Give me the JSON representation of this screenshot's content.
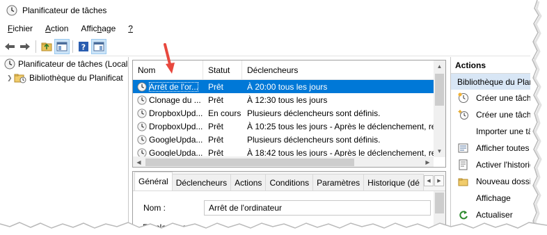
{
  "window": {
    "title": "Planificateur de tâches",
    "icon": "clock-icon"
  },
  "menu": [
    {
      "label": "Fichier",
      "underline": "F"
    },
    {
      "label": "Action",
      "underline": "A"
    },
    {
      "label": "Affichage",
      "underline": "h"
    },
    {
      "label": "?",
      "underline": "?"
    }
  ],
  "toolbar": {
    "buttons": [
      "back-arrow-icon",
      "forward-arrow-icon",
      "folder-up-icon",
      "show-hide-tree-icon",
      "help-icon",
      "show-hide-actions-icon"
    ]
  },
  "tree": {
    "root_label": "Planificateur de tâches (Local",
    "child_label": "Bibliothèque du Planificat"
  },
  "grid": {
    "headers": {
      "name": "Nom",
      "status": "Statut",
      "triggers": "Déclencheurs"
    },
    "rows": [
      {
        "name": "Arrêt de l'or...",
        "status": "Prêt",
        "triggers": "À 20:00 tous les jours",
        "selected": true
      },
      {
        "name": "Clonage du ...",
        "status": "Prêt",
        "triggers": "À 12:30 tous les jours",
        "selected": false
      },
      {
        "name": "DropboxUpd...",
        "status": "En cours",
        "triggers": "Plusieurs déclencheurs sont définis.",
        "selected": false
      },
      {
        "name": "DropboxUpd...",
        "status": "Prêt",
        "triggers": "À 10:25 tous les jours - Après le déclenchement, red",
        "selected": false
      },
      {
        "name": "GoogleUpda...",
        "status": "Prêt",
        "triggers": "Plusieurs déclencheurs sont définis.",
        "selected": false
      },
      {
        "name": "GoogleUpda...",
        "status": "Prêt",
        "triggers": "À 18:42 tous les jours - Après le déclenchement, rec",
        "selected": false
      }
    ]
  },
  "detail": {
    "tabs": [
      "Général",
      "Déclencheurs",
      "Actions",
      "Conditions",
      "Paramètres",
      "Historique (dé"
    ],
    "active_tab": 0,
    "name_label": "Nom :",
    "name_value": "Arrêt de l'ordinateur",
    "partial_label": "Emplacement :"
  },
  "actions": {
    "header": "Actions",
    "section": "Bibliothèque du Planificateur",
    "items": [
      {
        "label": "Créer une tâche de base...",
        "icon": "create-basic-task-icon"
      },
      {
        "label": "Créer une tâche...",
        "icon": "create-task-icon"
      },
      {
        "label": "Importer une tâche...",
        "icon": ""
      },
      {
        "label": "Afficher toutes les tâches en cours",
        "icon": "running-tasks-icon"
      },
      {
        "label": "Activer l'historique",
        "icon": "history-icon"
      },
      {
        "label": "Nouveau dossier...",
        "icon": "new-folder-icon"
      },
      {
        "label": "Affichage",
        "icon": ""
      },
      {
        "label": "Actualiser",
        "icon": "refresh-icon"
      }
    ]
  },
  "colors": {
    "selection": "#0078d7",
    "actions_section_bg": "#d8e6f5",
    "annotation_arrow": "#e8483e"
  }
}
